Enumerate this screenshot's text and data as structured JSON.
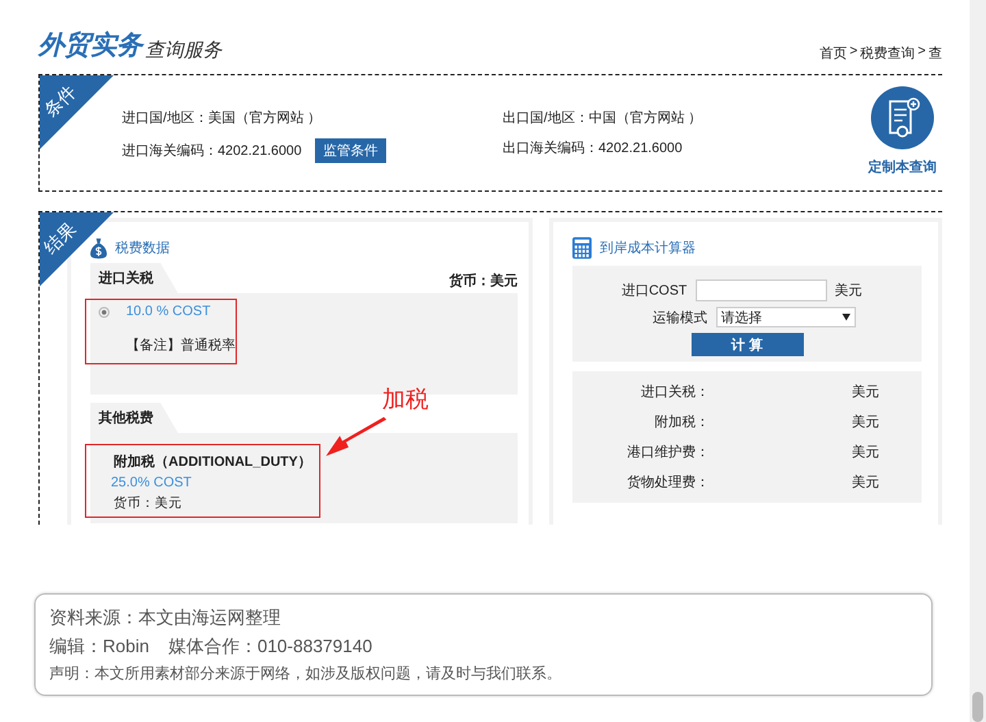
{
  "header": {
    "title": "外贸实务",
    "subtitle": "查询服务",
    "breadcrumb": [
      "首页",
      "税费查询",
      "查"
    ],
    "breadcrumb_separator": ">"
  },
  "conditions": {
    "tag": "条件",
    "fields": [
      {
        "label": "进口国/地区：",
        "value": "美国（官方网站 ）"
      },
      {
        "label": "出口国/地区：",
        "value": "中国（官方网站 ）"
      },
      {
        "label": "进口海关编码：",
        "value": "4202.21.6000"
      },
      {
        "label": "出口海关编码：",
        "value": "4202.21.6000"
      }
    ],
    "button": "监管条件",
    "custom_query": "定制本查询"
  },
  "results": {
    "tag": "结果",
    "tax_panel": {
      "title": "税费数据",
      "currency": "货币：美元",
      "import_duty": {
        "tab": "进口关税",
        "options": [
          {
            "rate": "10.0 % COST",
            "note": "【备注】普通税率",
            "selected": true
          }
        ]
      },
      "other_taxes": {
        "tab": "其他税费",
        "items": [
          {
            "name": "附加税（ADDITIONAL_DUTY）",
            "rate": "25.0% COST",
            "currency": "货币：美元"
          }
        ]
      }
    },
    "annotation": "加税",
    "calculator": {
      "title": "到岸成本计算器",
      "cost_label": "进口COST",
      "cost_unit": "美元",
      "mode_label": "运输模式",
      "mode_value": "请选择",
      "button": "计 算",
      "rows": [
        {
          "label": "进口关税：",
          "unit": "美元"
        },
        {
          "label": "附加税：",
          "unit": "美元"
        },
        {
          "label": "港口维护费：",
          "unit": "美元"
        },
        {
          "label": "货物处理费：",
          "unit": "美元"
        }
      ]
    }
  },
  "footer": {
    "source": "资料来源：本文由海运网整理",
    "editor": "编辑：Robin",
    "cooperation": "媒体合作：010-88379140",
    "disclaimer": "声明：本文所用素材部分来源于网络，如涉及版权问题，请及时与我们联系。"
  }
}
